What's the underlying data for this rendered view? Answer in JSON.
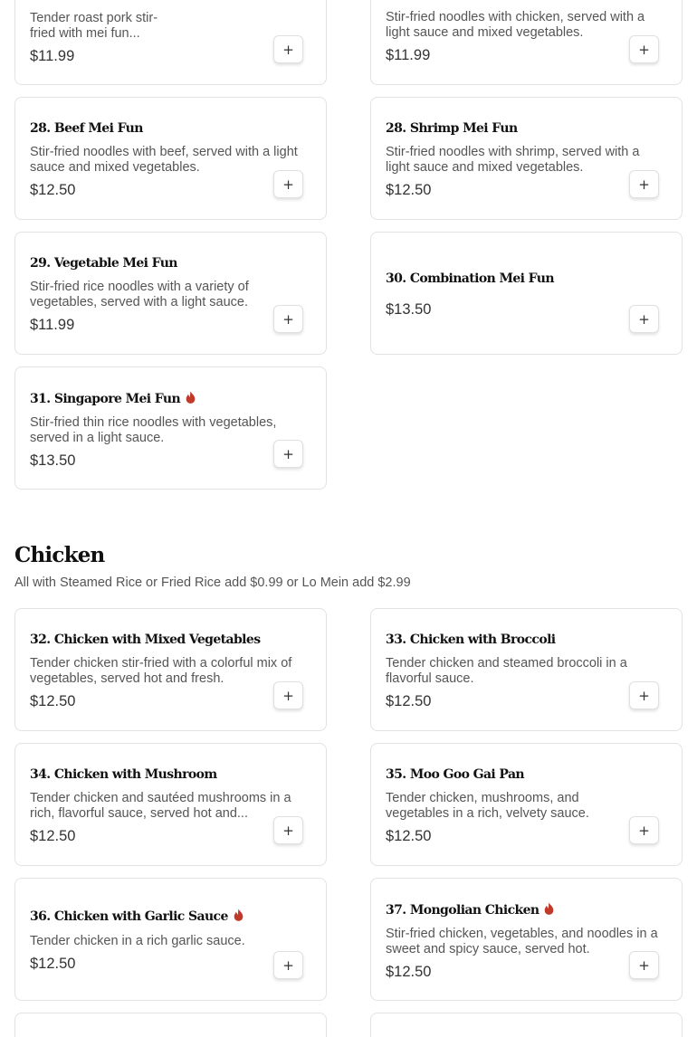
{
  "colors": {
    "spicy": "#c0392b",
    "card_border": "#e2e2e2",
    "text_dark": "#111111",
    "text_muted": "#555555"
  },
  "add_label": "+",
  "items": [
    {
      "name": "",
      "description": "Tender roast pork stir-fried with mei fun...",
      "price": "$11.99",
      "spicy": false
    },
    {
      "name": "",
      "description": "Stir-fried noodles with chicken, served with a light sauce and mixed vegetables.",
      "price": "$11.99",
      "spicy": false
    },
    {
      "name": "28. Beef Mei Fun",
      "description": "Stir-fried noodles with beef, served with a light sauce and mixed vegetables.",
      "price": "$12.50",
      "spicy": false
    },
    {
      "name": "28. Shrimp Mei Fun",
      "description": "Stir-fried noodles with shrimp, served with a light sauce and mixed vegetables.",
      "price": "$12.50",
      "spicy": false
    },
    {
      "name": "29. Vegetable Mei Fun",
      "description": "Stir-fried rice noodles with a variety of vegetables, served with a light sauce.",
      "price": "$11.99",
      "spicy": false
    },
    {
      "name": "30. Combination Mei Fun",
      "description": "",
      "price": "$13.50",
      "spicy": false
    },
    {
      "name": "31. Singapore Mei Fun",
      "description": "Stir-fried thin rice noodles with vegetables, served in a light sauce.",
      "price": "$13.50",
      "spicy": true
    }
  ],
  "chicken_section": {
    "title": "Chicken",
    "subtitle": "All with Steamed Rice or Fried Rice add $0.99 or Lo Mein add $2.99",
    "items": [
      {
        "name": "32. Chicken with Mixed Vegetables",
        "description": "Tender chicken stir-fried with a colorful mix of vegetables, served hot and fresh.",
        "price": "$12.50",
        "spicy": false
      },
      {
        "name": "33. Chicken with Broccoli",
        "description": "Tender chicken and steamed broccoli in a flavorful sauce.",
        "price": "$12.50",
        "spicy": false
      },
      {
        "name": "34. Chicken with Mushroom",
        "description": "Tender chicken and sautéed mushrooms in a rich, flavorful sauce, served hot and...",
        "price": "$12.50",
        "spicy": false
      },
      {
        "name": "35. Moo Goo Gai Pan",
        "description": "Tender chicken, mushrooms, and vegetables in a rich, velvety sauce.",
        "price": "$12.50",
        "spicy": false
      },
      {
        "name": "36. Chicken with Garlic Sauce",
        "description": "Tender chicken in a rich garlic sauce.",
        "price": "$12.50",
        "spicy": true
      },
      {
        "name": "37. Mongolian Chicken",
        "description": "Stir-fried chicken, vegetables, and noodles in a sweet and spicy sauce, served hot.",
        "price": "$12.50",
        "spicy": true
      }
    ]
  }
}
